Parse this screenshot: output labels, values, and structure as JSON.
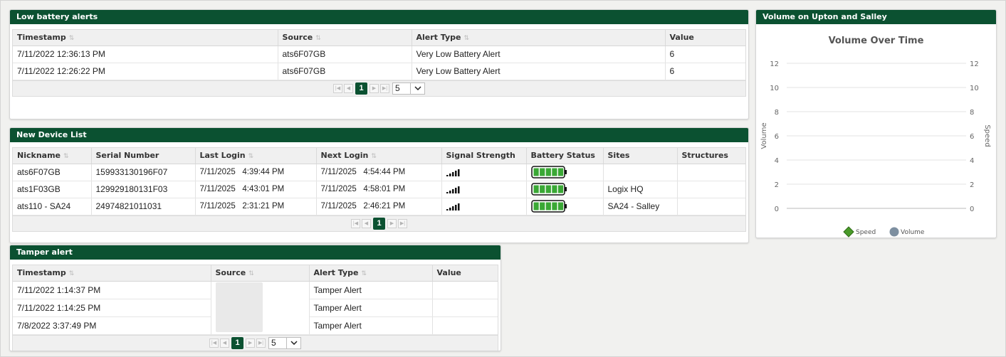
{
  "low_battery": {
    "title": "Low battery alerts",
    "columns": [
      "Timestamp",
      "Source",
      "Alert Type",
      "Value"
    ],
    "rows": [
      [
        "7/11/2022 12:36:13 PM",
        "ats6F07GB",
        "Very Low Battery Alert",
        "6"
      ],
      [
        "7/11/2022 12:26:22 PM",
        "ats6F07GB",
        "Very Low Battery Alert",
        "6"
      ]
    ],
    "page": "1",
    "page_size": "5"
  },
  "devices": {
    "title": "New Device List",
    "columns": [
      "Nickname",
      "Serial Number",
      "Last Login",
      "Next Login",
      "Signal Strength",
      "Battery Status",
      "Sites",
      "Structures"
    ],
    "rows": [
      {
        "nickname": "ats6F07GB",
        "serial": "159933130196F07",
        "last_date": "7/11/2025",
        "last_time": "4:39:44 PM",
        "next_date": "7/11/2025",
        "next_time": "4:54:44 PM",
        "signal_bars": 5,
        "battery_segments": 5,
        "site": "",
        "structures": ""
      },
      {
        "nickname": "ats1F03GB",
        "serial": "129929180131F03",
        "last_date": "7/11/2025",
        "last_time": "4:43:01 PM",
        "next_date": "7/11/2025",
        "next_time": "4:58:01 PM",
        "signal_bars": 5,
        "battery_segments": 5,
        "site": "Logix HQ",
        "structures": ""
      },
      {
        "nickname": "ats110 - SA24",
        "serial": "24974821011031",
        "last_date": "7/11/2025",
        "last_time": "2:31:21 PM",
        "next_date": "7/11/2025",
        "next_time": "2:46:21 PM",
        "signal_bars": 5,
        "battery_segments": 5,
        "site": "SA24 - Salley",
        "structures": ""
      }
    ],
    "page": "1"
  },
  "tamper": {
    "title": "Tamper alert",
    "columns": [
      "Timestamp",
      "Source",
      "Alert Type",
      "Value"
    ],
    "rows": [
      [
        "7/11/2022 1:14:37 PM",
        "",
        "Tamper Alert",
        ""
      ],
      [
        "7/11/2022 1:14:25 PM",
        "",
        "Tamper Alert",
        ""
      ],
      [
        "7/8/2022 3:37:49 PM",
        "",
        "Tamper Alert",
        ""
      ]
    ],
    "page": "1",
    "page_size": "5"
  },
  "volume_panel": {
    "title": "Volume on Upton and Salley"
  },
  "chart_data": {
    "type": "line",
    "title": "Volume Over Time",
    "ylabel": "Volume",
    "y2label": "Speed",
    "ylim": [
      0,
      12
    ],
    "y2lim": [
      0,
      12
    ],
    "yticks": [
      0,
      2,
      4,
      6,
      8,
      10,
      12
    ],
    "grid": true,
    "legend_position": "bottom",
    "series": [
      {
        "name": "Speed",
        "values": [],
        "color": "#4a9a2a",
        "marker": "diamond"
      },
      {
        "name": "Volume",
        "values": [],
        "color": "#7d8fa0",
        "marker": "circle"
      }
    ]
  },
  "colors": {
    "header_green": "#0b5131",
    "battery_green": "#3aa835"
  }
}
